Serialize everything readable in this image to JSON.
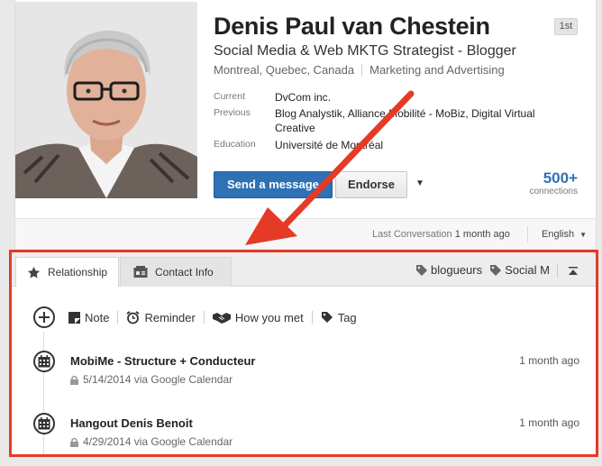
{
  "profile": {
    "name": "Denis Paul van Chestein",
    "degree_badge": "1st",
    "headline": "Social Media & Web MKTG Strategist - Blogger",
    "location": "Montreal, Quebec, Canada",
    "industry": "Marketing and Advertising",
    "info": [
      {
        "label": "Current",
        "value": "DvCom inc."
      },
      {
        "label": "Previous",
        "value": "Blog Analystik, Alliance Mobilité - MoBiz, Digital Virtual Creative"
      },
      {
        "label": "Education",
        "value": "Université de Montréal"
      }
    ],
    "buttons": {
      "send_message": "Send a message",
      "endorse": "Endorse"
    },
    "connections": {
      "count": "500+",
      "label": "connections"
    },
    "footer": {
      "last_conversation_label": "Last Conversation",
      "last_conversation_value": "1 month ago",
      "language": "English"
    }
  },
  "relationship_panel": {
    "tabs": [
      {
        "label": "Relationship",
        "icon": "star-icon",
        "active": true
      },
      {
        "label": "Contact Info",
        "icon": "contact-card-icon",
        "active": false
      }
    ],
    "tags": [
      "blogueurs",
      "Social M"
    ],
    "actions": [
      {
        "label": "Note",
        "icon": "note-icon"
      },
      {
        "label": "Reminder",
        "icon": "alarm-clock-icon"
      },
      {
        "label": "How you met",
        "icon": "handshake-icon"
      },
      {
        "label": "Tag",
        "icon": "tag-icon"
      }
    ],
    "entries": [
      {
        "title": "MobiMe - Structure + Conducteur",
        "when": "1 month ago",
        "meta": "5/14/2014 via Google Calendar"
      },
      {
        "title": "Hangout Denis Benoit",
        "when": "1 month ago",
        "meta": "4/29/2014 via Google Calendar"
      }
    ]
  },
  "colors": {
    "primary_blue": "#2e71b5",
    "highlight_red": "#e53a26",
    "panel_background": "#ffffff",
    "page_background": "#e9e9e9"
  }
}
